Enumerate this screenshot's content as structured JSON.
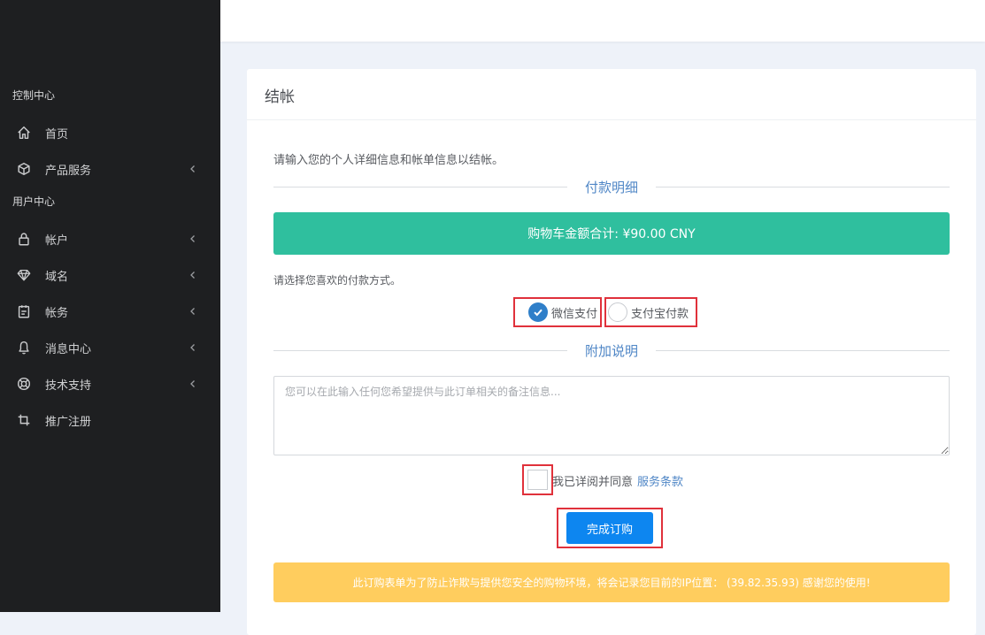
{
  "sidebar": {
    "sections": [
      "控制中心",
      "用户中心"
    ],
    "items": [
      {
        "label": "首页",
        "icon": "home-icon",
        "has_submenu": false
      },
      {
        "label": "产品服务",
        "icon": "cube-icon",
        "has_submenu": true
      },
      {
        "label": "帐户",
        "icon": "lock-icon",
        "has_submenu": true
      },
      {
        "label": "域名",
        "icon": "diamond-icon",
        "has_submenu": true
      },
      {
        "label": "帐务",
        "icon": "clipboard-icon",
        "has_submenu": true
      },
      {
        "label": "消息中心",
        "icon": "bell-icon",
        "has_submenu": true
      },
      {
        "label": "技术支持",
        "icon": "lifebuoy-icon",
        "has_submenu": true
      },
      {
        "label": "推广注册",
        "icon": "crop-icon",
        "has_submenu": false
      }
    ]
  },
  "checkout": {
    "title": "结帐",
    "intro": "请输入您的个人详细信息和帐单信息以结帐。",
    "payment_section": "付款明细",
    "total_text": "购物车金额合计: ¥90.00 CNY",
    "payment_prompt": "请选择您喜欢的付款方式。",
    "methods": [
      {
        "label": "微信支付",
        "selected": true
      },
      {
        "label": "支付宝付款",
        "selected": false
      }
    ],
    "notes_section": "附加说明",
    "notes_placeholder": "您可以在此输入任何您希望提供与此订单相关的备注信息...",
    "agree_text": "我已详阅并同意",
    "terms_link": "服务条款",
    "agree_checked": false,
    "submit_label": "完成订购",
    "warning": "此订购表单为了防止诈欺与提供您安全的购物环境，将会记录您目前的IP位置： (39.82.35.93) 感谢您的使用!"
  },
  "colors": {
    "sidebar_bg": "#1e1f21",
    "accent_blue": "#4f86c6",
    "total_green": "#2fbf9e",
    "submit_blue": "#0d86f0",
    "warning_yellow": "#ffcd5e",
    "highlight_red": "#e0313b"
  }
}
